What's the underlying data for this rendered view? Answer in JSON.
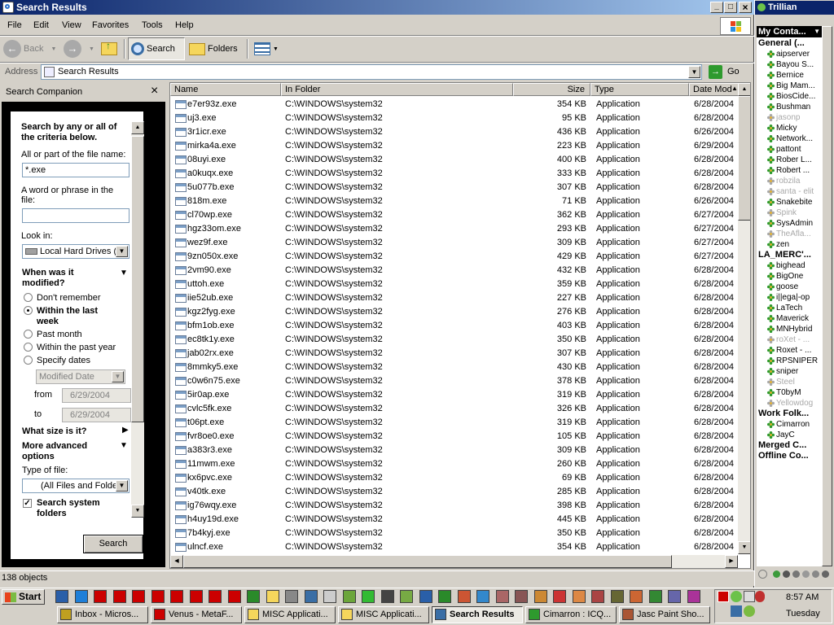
{
  "window": {
    "title": "Search Results",
    "min": "_",
    "max": "□",
    "close": "×"
  },
  "menu": [
    "File",
    "Edit",
    "View",
    "Favorites",
    "Tools",
    "Help"
  ],
  "toolbar": {
    "back": "Back",
    "search": "Search",
    "folders": "Folders"
  },
  "address": {
    "label": "Address",
    "value": "Search Results",
    "go": "Go"
  },
  "companion": {
    "title": "Search Companion",
    "close": "×",
    "heading": "Search by any or all of the criteria below.",
    "name_label": "All or part of the file name:",
    "name_value": "*.exe",
    "phrase_label": "A word or phrase in the file:",
    "phrase_value": "",
    "lookin_label": "Look in:",
    "lookin_value": "Local Hard Drives (C",
    "modified_heading": "When was it modified?",
    "radios": [
      "Don't remember",
      "Within the last week",
      "Past month",
      "Within the past year",
      "Specify dates"
    ],
    "date_type": "Modified Date",
    "from_label": "from",
    "from_value": "6/29/2004",
    "to_label": "to",
    "to_value": "6/29/2004",
    "size_heading": "What size is it?",
    "advanced_heading": "More advanced options",
    "type_label": "Type of file:",
    "type_value": "(All Files and Folder",
    "system_check": "Search system folders",
    "search_button": "Search"
  },
  "columns": {
    "name": "Name",
    "folder": "In Folder",
    "size": "Size",
    "type": "Type",
    "date": "Date Modifie"
  },
  "files": [
    {
      "name": "e7er93z.exe",
      "folder": "C:\\WINDOWS\\system32",
      "size": "354 KB",
      "type": "Application",
      "date": "6/28/2004 1"
    },
    {
      "name": "uj3.exe",
      "folder": "C:\\WINDOWS\\system32",
      "size": "95 KB",
      "type": "Application",
      "date": "6/28/2004 9"
    },
    {
      "name": "3r1icr.exe",
      "folder": "C:\\WINDOWS\\system32",
      "size": "436 KB",
      "type": "Application",
      "date": "6/26/2004 7"
    },
    {
      "name": "mirka4a.exe",
      "folder": "C:\\WINDOWS\\system32",
      "size": "223 KB",
      "type": "Application",
      "date": "6/29/2004 8"
    },
    {
      "name": "08uyi.exe",
      "folder": "C:\\WINDOWS\\system32",
      "size": "400 KB",
      "type": "Application",
      "date": "6/28/2004 3"
    },
    {
      "name": "a0kuqx.exe",
      "folder": "C:\\WINDOWS\\system32",
      "size": "333 KB",
      "type": "Application",
      "date": "6/28/2004 9"
    },
    {
      "name": "5u077b.exe",
      "folder": "C:\\WINDOWS\\system32",
      "size": "307 KB",
      "type": "Application",
      "date": "6/28/2004 9"
    },
    {
      "name": "818m.exe",
      "folder": "C:\\WINDOWS\\system32",
      "size": "71 KB",
      "type": "Application",
      "date": "6/26/2004 7"
    },
    {
      "name": "cl70wp.exe",
      "folder": "C:\\WINDOWS\\system32",
      "size": "362 KB",
      "type": "Application",
      "date": "6/27/2004 1"
    },
    {
      "name": "hgz33om.exe",
      "folder": "C:\\WINDOWS\\system32",
      "size": "293 KB",
      "type": "Application",
      "date": "6/27/2004 7"
    },
    {
      "name": "wez9f.exe",
      "folder": "C:\\WINDOWS\\system32",
      "size": "309 KB",
      "type": "Application",
      "date": "6/27/2004 2"
    },
    {
      "name": "9zn050x.exe",
      "folder": "C:\\WINDOWS\\system32",
      "size": "429 KB",
      "type": "Application",
      "date": "6/27/2004 7"
    },
    {
      "name": "2vm90.exe",
      "folder": "C:\\WINDOWS\\system32",
      "size": "432 KB",
      "type": "Application",
      "date": "6/28/2004 2"
    },
    {
      "name": "uttoh.exe",
      "folder": "C:\\WINDOWS\\system32",
      "size": "359 KB",
      "type": "Application",
      "date": "6/28/2004 7"
    },
    {
      "name": "iie52ub.exe",
      "folder": "C:\\WINDOWS\\system32",
      "size": "227 KB",
      "type": "Application",
      "date": "6/28/2004 8"
    },
    {
      "name": "kgz2fyg.exe",
      "folder": "C:\\WINDOWS\\system32",
      "size": "276 KB",
      "type": "Application",
      "date": "6/28/2004 8"
    },
    {
      "name": "bfm1ob.exe",
      "folder": "C:\\WINDOWS\\system32",
      "size": "403 KB",
      "type": "Application",
      "date": "6/28/2004 8"
    },
    {
      "name": "ec8tk1y.exe",
      "folder": "C:\\WINDOWS\\system32",
      "size": "350 KB",
      "type": "Application",
      "date": "6/28/2004 8"
    },
    {
      "name": "jab02rx.exe",
      "folder": "C:\\WINDOWS\\system32",
      "size": "307 KB",
      "type": "Application",
      "date": "6/28/2004 8"
    },
    {
      "name": "8mmky5.exe",
      "folder": "C:\\WINDOWS\\system32",
      "size": "430 KB",
      "type": "Application",
      "date": "6/28/2004 8"
    },
    {
      "name": "c0w6n75.exe",
      "folder": "C:\\WINDOWS\\system32",
      "size": "378 KB",
      "type": "Application",
      "date": "6/28/2004 8"
    },
    {
      "name": "5ir0ap.exe",
      "folder": "C:\\WINDOWS\\system32",
      "size": "319 KB",
      "type": "Application",
      "date": "6/28/2004 9"
    },
    {
      "name": "cvlc5fk.exe",
      "folder": "C:\\WINDOWS\\system32",
      "size": "326 KB",
      "type": "Application",
      "date": "6/28/2004 9"
    },
    {
      "name": "t06pt.exe",
      "folder": "C:\\WINDOWS\\system32",
      "size": "319 KB",
      "type": "Application",
      "date": "6/28/2004 9"
    },
    {
      "name": "fvr8oe0.exe",
      "folder": "C:\\WINDOWS\\system32",
      "size": "105 KB",
      "type": "Application",
      "date": "6/28/2004 9"
    },
    {
      "name": "a383r3.exe",
      "folder": "C:\\WINDOWS\\system32",
      "size": "309 KB",
      "type": "Application",
      "date": "6/28/2004 9"
    },
    {
      "name": "11mwm.exe",
      "folder": "C:\\WINDOWS\\system32",
      "size": "260 KB",
      "type": "Application",
      "date": "6/28/2004 9"
    },
    {
      "name": "kx6pvc.exe",
      "folder": "C:\\WINDOWS\\system32",
      "size": "69 KB",
      "type": "Application",
      "date": "6/28/2004 9"
    },
    {
      "name": "v40tk.exe",
      "folder": "C:\\WINDOWS\\system32",
      "size": "285 KB",
      "type": "Application",
      "date": "6/28/2004 9"
    },
    {
      "name": "ig76wqy.exe",
      "folder": "C:\\WINDOWS\\system32",
      "size": "398 KB",
      "type": "Application",
      "date": "6/28/2004 9"
    },
    {
      "name": "h4uy19d.exe",
      "folder": "C:\\WINDOWS\\system32",
      "size": "445 KB",
      "type": "Application",
      "date": "6/28/2004 9"
    },
    {
      "name": "7b4kyj.exe",
      "folder": "C:\\WINDOWS\\system32",
      "size": "350 KB",
      "type": "Application",
      "date": "6/28/2004 9"
    },
    {
      "name": "ulncf.exe",
      "folder": "C:\\WINDOWS\\system32",
      "size": "354 KB",
      "type": "Application",
      "date": "6/28/2004 1"
    }
  ],
  "status": "138 objects",
  "trillian": {
    "title": "Trillian",
    "header": "My Conta...",
    "groups": [
      {
        "name": "General (...",
        "contacts": [
          {
            "name": "aipserver",
            "online": true
          },
          {
            "name": "Bayou S...",
            "online": true
          },
          {
            "name": "Bernice",
            "online": true
          },
          {
            "name": "Big Mam...",
            "online": true
          },
          {
            "name": "BiosCide...",
            "online": true
          },
          {
            "name": "Bushman",
            "online": true
          },
          {
            "name": "jasonp",
            "online": false
          },
          {
            "name": "Micky",
            "online": true
          },
          {
            "name": "Network...",
            "online": true
          },
          {
            "name": "pattont",
            "online": true
          },
          {
            "name": "Rober L...",
            "online": true
          },
          {
            "name": "Robert ...",
            "online": true
          },
          {
            "name": "robzila",
            "online": false
          },
          {
            "name": "santa - elit",
            "online": false
          },
          {
            "name": "Snakebite",
            "online": true
          },
          {
            "name": "Spink",
            "online": false
          },
          {
            "name": "SysAdmin",
            "online": true
          },
          {
            "name": "TheAfla...",
            "online": false
          },
          {
            "name": "zen",
            "online": true
          }
        ]
      },
      {
        "name": "LA_MERC'...",
        "contacts": [
          {
            "name": "bighead",
            "online": true
          },
          {
            "name": "BigOne",
            "online": true
          },
          {
            "name": "goose",
            "online": true
          },
          {
            "name": "i||ega|-op",
            "online": true
          },
          {
            "name": "LaTech",
            "online": true
          },
          {
            "name": "Maverick",
            "online": true
          },
          {
            "name": "MNHybrid",
            "online": true
          },
          {
            "name": "roXet - ...",
            "online": false
          },
          {
            "name": "Roxet - ...",
            "online": true
          },
          {
            "name": "RPSNIPER",
            "online": true
          },
          {
            "name": "sniper",
            "online": true
          },
          {
            "name": "Steel",
            "online": false
          },
          {
            "name": "T0byM",
            "online": true
          },
          {
            "name": "Yellowdog",
            "online": false
          }
        ]
      },
      {
        "name": "Work Folk...",
        "contacts": [
          {
            "name": "Cimarron",
            "online": true
          },
          {
            "name": "JayC",
            "online": true
          }
        ]
      },
      {
        "name": "Merged C...",
        "contacts": []
      },
      {
        "name": "Offline Co...",
        "contacts": []
      }
    ]
  },
  "taskbar": {
    "start": "Start",
    "tasks": [
      {
        "label": "Inbox - Micros...",
        "active": false
      },
      {
        "label": "Venus - MetaF...",
        "active": false
      },
      {
        "label": "MISC Applicati...",
        "active": false
      },
      {
        "label": "MISC Applicati...",
        "active": false
      },
      {
        "label": "Search Results",
        "active": true
      },
      {
        "label": "Cimarron : ICQ...",
        "active": false
      },
      {
        "label": "Jasc Paint Sho...",
        "active": false
      }
    ],
    "time": "8:57 AM",
    "day": "Tuesday"
  }
}
